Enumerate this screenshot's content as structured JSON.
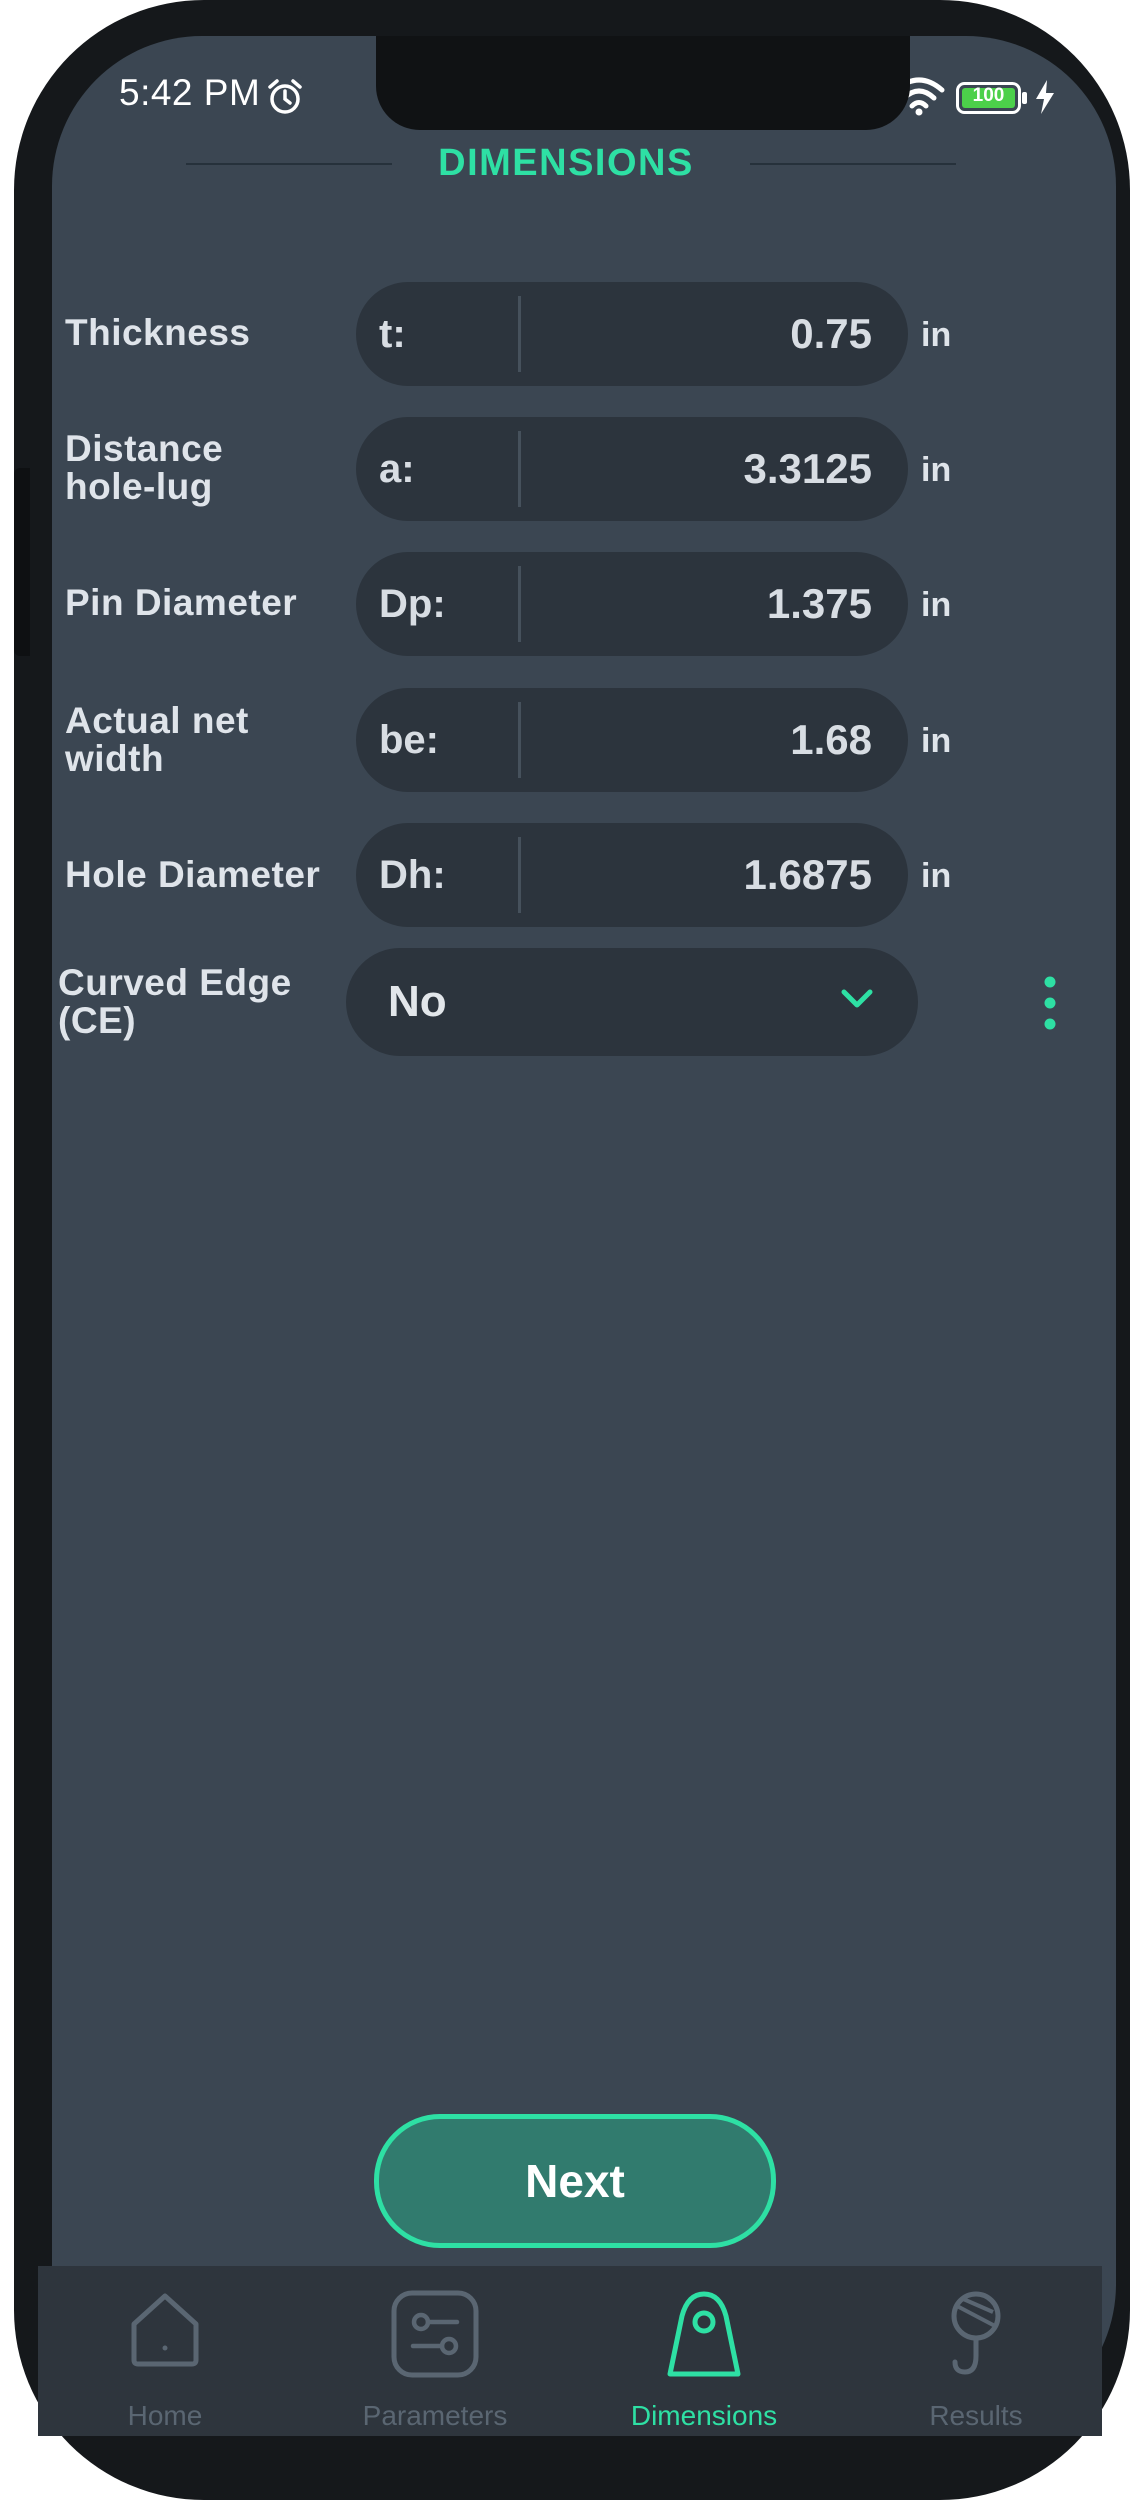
{
  "status_bar": {
    "time": "5:42 PM",
    "battery": "100"
  },
  "header": {
    "title": "DIMENSIONS"
  },
  "fields": [
    {
      "label_line1": "Thickness",
      "label_line2": "",
      "symbol": "t:",
      "value": "0.75",
      "unit": "in"
    },
    {
      "label_line1": "Distance",
      "label_line2": "hole-lug",
      "symbol": "a:",
      "value": "3.3125",
      "unit": "in"
    },
    {
      "label_line1": "Pin Diameter",
      "label_line2": "",
      "symbol": "Dp:",
      "value": "1.375",
      "unit": "in"
    },
    {
      "label_line1": "Actual net",
      "label_line2": "width",
      "symbol": "be:",
      "value": "1.68",
      "unit": "in"
    },
    {
      "label_line1": "Hole Diameter",
      "label_line2": "",
      "symbol": "Dh:",
      "value": "1.6875",
      "unit": "in"
    }
  ],
  "curved_edge": {
    "label_line1": "Curved Edge",
    "label_line2": "(CE)",
    "selected": "No"
  },
  "next_button": {
    "label": "Next"
  },
  "tabs": [
    {
      "label": "Home",
      "icon": "home-icon",
      "active": false
    },
    {
      "label": "Parameters",
      "icon": "sliders-icon",
      "active": false
    },
    {
      "label": "Dimensions",
      "icon": "lug-icon",
      "active": true
    },
    {
      "label": "Results",
      "icon": "crane-hook-icon",
      "active": false
    }
  ],
  "colors": {
    "accent": "#2ee0a4",
    "background": "#3b4652",
    "field": "#2c343d",
    "tabbar": "#2e353d",
    "inactive_tab": "#5a6672"
  }
}
